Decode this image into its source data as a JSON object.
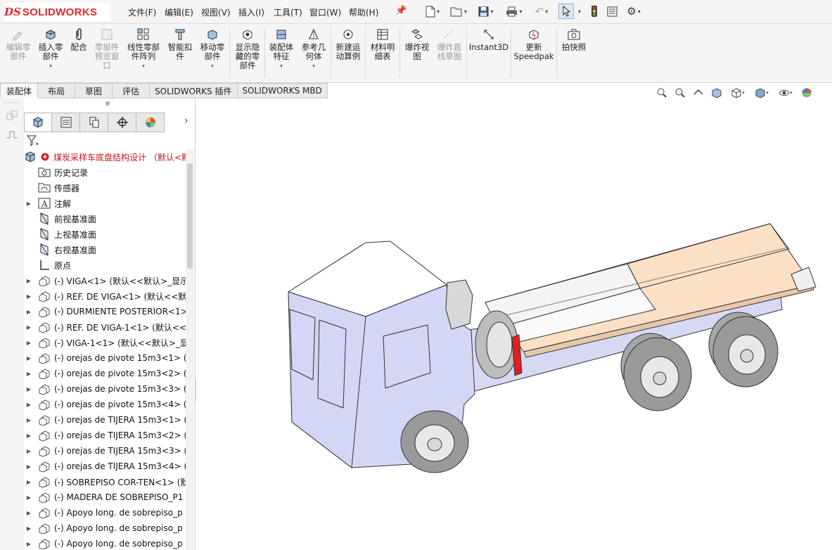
{
  "app": {
    "brand_mark": "DS",
    "brand_name": "SOLIDWORKS"
  },
  "menu": {
    "items": [
      "文件(F)",
      "编辑(E)",
      "视图(V)",
      "插入(I)",
      "工具(T)",
      "窗口(W)",
      "帮助(H)"
    ]
  },
  "ribbon": {
    "buttons": [
      {
        "label": "编辑零\n部件",
        "icon": "edit-component-icon",
        "enabled": false
      },
      {
        "label": "插入零\n部件",
        "icon": "insert-component-icon",
        "enabled": true
      },
      {
        "label": "配合",
        "icon": "mate-icon",
        "enabled": true
      },
      {
        "label": "零部件\n预览窗\n口",
        "icon": "component-preview-icon",
        "enabled": false
      },
      {
        "label": "线性零部\n件阵列",
        "icon": "linear-pattern-icon",
        "enabled": true
      },
      {
        "label": "智能扣\n件",
        "icon": "smart-fasteners-icon",
        "enabled": true
      },
      {
        "label": "移动零\n部件",
        "icon": "move-component-icon",
        "enabled": true
      },
      {
        "label": "显示隐\n藏的零\n部件",
        "icon": "show-hidden-icon",
        "enabled": true
      },
      {
        "label": "装配体\n特征",
        "icon": "assembly-features-icon",
        "enabled": true
      },
      {
        "label": "参考几\n何体",
        "icon": "reference-geometry-icon",
        "enabled": true
      },
      {
        "label": "新建运\n动算例",
        "icon": "motion-study-icon",
        "enabled": true
      },
      {
        "label": "材料明\n细表",
        "icon": "bom-icon",
        "enabled": true
      },
      {
        "label": "爆炸视\n图",
        "icon": "exploded-view-icon",
        "enabled": true
      },
      {
        "label": "爆炸直\n线草图",
        "icon": "explode-line-sketch-icon",
        "enabled": false
      },
      {
        "label": "Instant3D",
        "icon": "instant3d-icon",
        "enabled": true
      },
      {
        "label": "更新\nSpeedpak",
        "icon": "speedpak-icon",
        "enabled": true
      },
      {
        "label": "拍快照",
        "icon": "snapshot-icon",
        "enabled": true
      }
    ]
  },
  "tabs": [
    "装配体",
    "布局",
    "草图",
    "评估",
    "SOLIDWORKS 插件",
    "SOLIDWORKS MBD"
  ],
  "tree": {
    "root": "煤炭采样车底盘结构设计 （默认<默",
    "items": [
      {
        "label": "历史记录",
        "icon": "history-icon",
        "expandable": false
      },
      {
        "label": "传感器",
        "icon": "sensor-icon",
        "expandable": false
      },
      {
        "label": "注解",
        "icon": "annotations-icon",
        "expandable": true
      },
      {
        "label": "前视基准面",
        "icon": "plane-icon",
        "expandable": false
      },
      {
        "label": "上视基准面",
        "icon": "plane-icon",
        "expandable": false
      },
      {
        "label": "右视基准面",
        "icon": "plane-icon",
        "expandable": false
      },
      {
        "label": "原点",
        "icon": "origin-icon",
        "expandable": false
      },
      {
        "label": "(-) VIGA<1> (默认<<默认>_显示",
        "icon": "part-icon",
        "expandable": true
      },
      {
        "label": "(-) REF. DE VIGA<1> (默认<<默",
        "icon": "part-icon",
        "expandable": true
      },
      {
        "label": "(-) DURMIENTE POSTERIOR<1>",
        "icon": "part-icon",
        "expandable": true
      },
      {
        "label": "(-) REF. DE VIGA-1<1> (默认<<",
        "icon": "part-icon",
        "expandable": true
      },
      {
        "label": "(-) VIGA-1<1> (默认<<默认>_显",
        "icon": "part-icon",
        "expandable": true
      },
      {
        "label": "(-) orejas de pivote 15m3<1> (",
        "icon": "part-icon",
        "expandable": true
      },
      {
        "label": "(-) orejas de pivote 15m3<2> (",
        "icon": "part-icon",
        "expandable": true
      },
      {
        "label": "(-) orejas de pivote 15m3<3> (",
        "icon": "part-icon",
        "expandable": true
      },
      {
        "label": "(-) orejas de pivote 15m3<4> (",
        "icon": "part-icon",
        "expandable": true
      },
      {
        "label": "(-) orejas de TIJERA 15m3<1> (",
        "icon": "part-icon",
        "expandable": true
      },
      {
        "label": "(-) orejas de TIJERA 15m3<2> (",
        "icon": "part-icon",
        "expandable": true
      },
      {
        "label": "(-) orejas de TIJERA 15m3<3> (",
        "icon": "part-icon",
        "expandable": true
      },
      {
        "label": "(-) orejas de TIJERA 15m3<4> (",
        "icon": "part-icon",
        "expandable": true
      },
      {
        "label": "(-) SOBREPISO COR-TEN<1> (默",
        "icon": "part-icon",
        "expandable": true
      },
      {
        "label": "(-) MADERA DE SOBREPISO_P1",
        "icon": "part-icon",
        "expandable": true
      },
      {
        "label": "(-) Apoyo long. de sobrepiso_p",
        "icon": "part-icon",
        "expandable": true
      },
      {
        "label": "(-) Apoyo long. de sobrepiso_p",
        "icon": "part-icon",
        "expandable": true
      },
      {
        "label": "(-) Apoyo long. de sobrepiso_p",
        "icon": "part-icon",
        "expandable": true
      }
    ]
  },
  "colors": {
    "accent": "#e3262e",
    "cab": "#d4d6f5",
    "deck": "#fbdcc0",
    "extinguisher": "#e02020"
  }
}
